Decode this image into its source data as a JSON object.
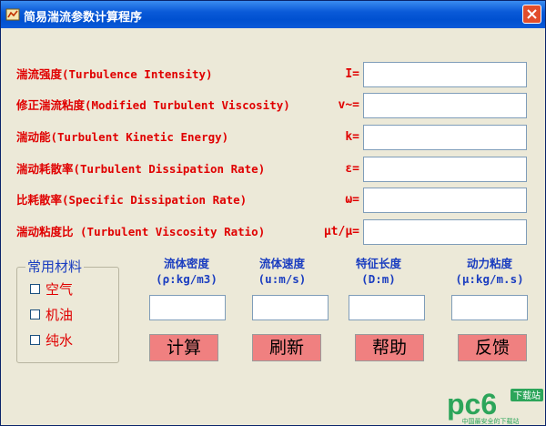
{
  "window": {
    "title": "简易湍流参数计算程序",
    "icon": "app-icon",
    "close_icon": "close-icon"
  },
  "fields": [
    {
      "label": "湍流强度(Turbulence Intensity)",
      "symbol": "I="
    },
    {
      "label": "修正湍流粘度(Modified Turbulent Viscosity)",
      "symbol": "v~="
    },
    {
      "label": "湍动能(Turbulent Kinetic Energy)",
      "symbol": "k="
    },
    {
      "label": "湍动耗散率(Turbulent Dissipation Rate)",
      "symbol": "ε="
    },
    {
      "label": "比耗散率(Specific Dissipation Rate)",
      "symbol": "ω="
    },
    {
      "label": "湍动粘度比 (Turbulent Viscosity Ratio)",
      "symbol": "μt/μ="
    }
  ],
  "materials": {
    "title": "常用材料",
    "options": [
      {
        "label": "空气",
        "checked": false
      },
      {
        "label": "机油",
        "checked": false
      },
      {
        "label": "纯水",
        "checked": false
      }
    ]
  },
  "params": [
    {
      "name": "流体密度",
      "unit": "(ρ:kg/m3)"
    },
    {
      "name": "流体速度",
      "unit": "(u:m/s)"
    },
    {
      "name": "特征长度",
      "unit": "(D:m)"
    },
    {
      "name": "动力粘度",
      "unit": "(μ:kg/m.s)"
    }
  ],
  "buttons": {
    "calculate": "计算",
    "refresh": "刷新",
    "help": "帮助",
    "feedback": "反馈"
  },
  "watermark": {
    "brand": "pc6",
    "tag": "下载站",
    "slogan": "中国最安全的下载站"
  },
  "colors": {
    "label": "#e00000",
    "heading": "#1a3dc0",
    "button": "#f08080",
    "titlebar": "#0a5ad8"
  }
}
